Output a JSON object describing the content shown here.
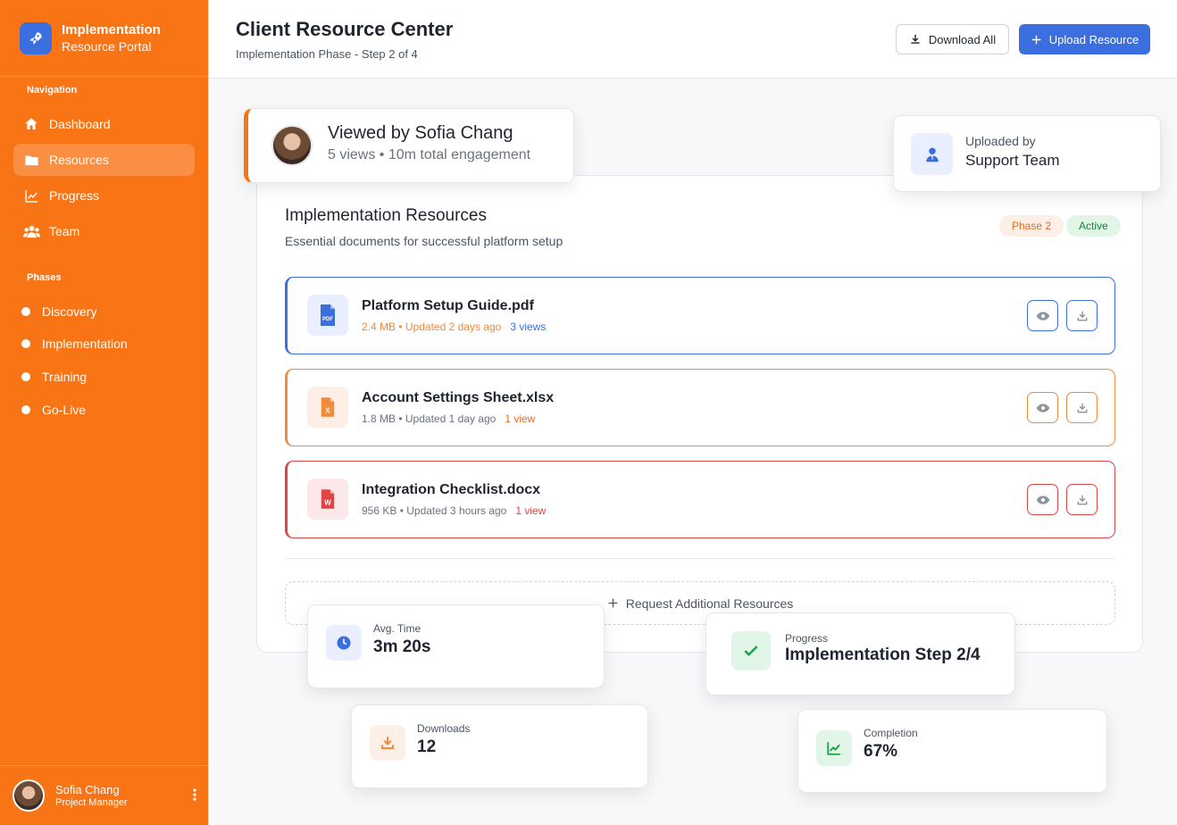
{
  "sidebar": {
    "brand_title": "Implementation",
    "brand_subtitle": "Resource Portal",
    "nav_label": "Navigation",
    "nav_items": [
      {
        "label": "Dashboard",
        "icon": "home-icon"
      },
      {
        "label": "Resources",
        "icon": "folder-icon",
        "active": true
      },
      {
        "label": "Progress",
        "icon": "chart-line-icon"
      },
      {
        "label": "Team",
        "icon": "users-icon"
      }
    ],
    "phases_label": "Phases",
    "phases": [
      "Discovery",
      "Implementation",
      "Training",
      "Go-Live"
    ],
    "user": {
      "name": "Sofia Chang",
      "role": "Project Manager"
    }
  },
  "header": {
    "title": "Client Resource Center",
    "subtitle": "Implementation Phase - Step 2 of 4",
    "download_all": "Download All",
    "upload": "Upload Resource"
  },
  "viewed": {
    "title": "Viewed by Sofia Chang",
    "subtitle": "5 views • 10m total engagement"
  },
  "uploaded": {
    "label": "Uploaded by",
    "value": "Support Team"
  },
  "main": {
    "title": "Implementation Resources",
    "subtitle": "Essential documents for successful platform setup",
    "badge_phase": "Phase 2",
    "badge_active": "Active",
    "files": [
      {
        "name": "Platform Setup Guide.pdf",
        "meta": "2.4 MB • Updated 2 days ago",
        "views": "3 views",
        "color": "#3b6fe0",
        "meta_color": "#f08a3c",
        "icon": "pdf-icon",
        "icon_bg": "#e9efff"
      },
      {
        "name": "Account Settings Sheet.xlsx",
        "meta": "1.8 MB • Updated 1 day ago",
        "views": "1 view",
        "color": "#f08a3c",
        "meta_color": "#6b7280",
        "icon": "excel-icon",
        "icon_bg": "#fdeee6"
      },
      {
        "name": "Integration Checklist.docx",
        "meta": "956 KB • Updated 3 hours ago",
        "views": "1 view",
        "color": "#e04545",
        "meta_color": "#6b7280",
        "icon": "word-icon",
        "icon_bg": "#fce8e8"
      }
    ],
    "request": "Request Additional Resources"
  },
  "stats": {
    "avg_time": {
      "label": "Avg. Time",
      "value": "3m 20s"
    },
    "progress": {
      "label": "Progress",
      "value": "Implementation Step 2/4"
    },
    "downloads": {
      "label": "Downloads",
      "value": "12"
    },
    "completion": {
      "label": "Completion",
      "value": "67%"
    }
  }
}
